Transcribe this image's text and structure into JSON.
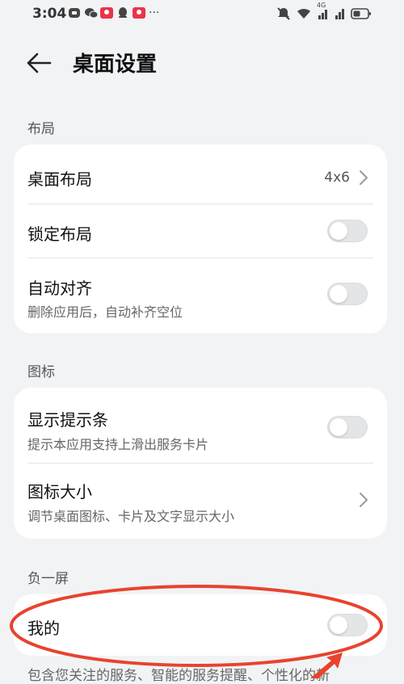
{
  "status_bar": {
    "time": "3:04",
    "left_icons": [
      "app-icon",
      "wechat-icon",
      "red-app-icon",
      "qq-icon",
      "red-app-icon",
      "more-dots-icon"
    ],
    "right_icons": [
      "mute-icon",
      "wifi-icon",
      "4g-signal-icon",
      "signal-icon",
      "battery-icon"
    ],
    "more": "···",
    "network": "4G"
  },
  "header": {
    "title": "桌面设置"
  },
  "sections": {
    "layout": {
      "label": "布局",
      "desktop_layout": {
        "title": "桌面布局",
        "value": "4x6"
      },
      "lock_layout": {
        "title": "锁定布局",
        "enabled": false
      },
      "auto_align": {
        "title": "自动对齐",
        "subtitle": "删除应用后，自动补齐空位",
        "enabled": false
      }
    },
    "icons": {
      "label": "图标",
      "show_hint_bar": {
        "title": "显示提示条",
        "subtitle": "提示本应用支持上滑出服务卡片",
        "enabled": false
      },
      "icon_size": {
        "title": "图标大小",
        "subtitle": "调节桌面图标、卡片及文字显示大小"
      }
    },
    "minus_one_screen": {
      "label": "负一屏",
      "mine": {
        "title": "我的",
        "enabled": false
      },
      "footer_text": "包含您关注的服务、智能的服务提醒、个性化的新"
    }
  },
  "annotation": {
    "color": "#e8432e"
  }
}
